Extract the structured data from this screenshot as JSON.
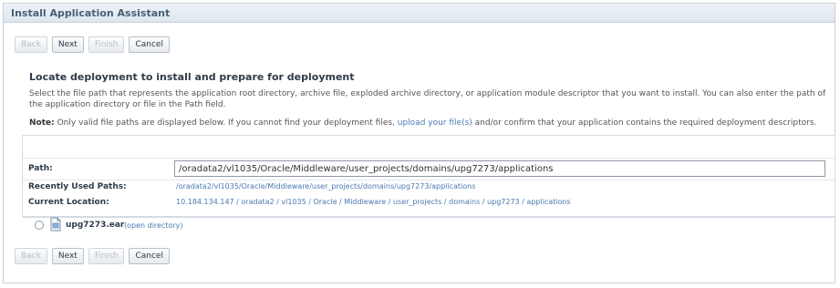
{
  "header": {
    "title": "Install Application Assistant"
  },
  "buttons": {
    "back": "Back",
    "next": "Next",
    "finish": "Finish",
    "cancel": "Cancel"
  },
  "section": {
    "title": "Locate deployment to install and prepare for deployment",
    "description": "Select the file path that represents the application root directory, archive file, exploded archive directory, or application module descriptor that you want to install. You can also enter the path of the application directory or file in the Path field.",
    "note_label": "Note:",
    "note_text_before": " Only valid file paths are displayed below. If you cannot find your deployment files, ",
    "note_link": "upload your file(s)",
    "note_text_after": " and/or confirm that your application contains the required deployment descriptors."
  },
  "form": {
    "path_label": "Path:",
    "path_value": "/oradata2/vl1035/Oracle/Middleware/user_projects/domains/upg7273/applications",
    "recent_label": "Recently Used Paths:",
    "recent_path": "/oradata2/vl1035/Oracle/Middleware/user_projects/domains/upg7273/applications",
    "location_label": "Current Location:",
    "location_path": "10.184.134.147 / oradata2 / vl1035 / Oracle / Middleware / user_projects / domains / upg7273 / applications"
  },
  "files": [
    {
      "name": "upg7273.ear",
      "action": "(open directory)",
      "selected": false,
      "icon": "archive-file-icon"
    }
  ]
}
